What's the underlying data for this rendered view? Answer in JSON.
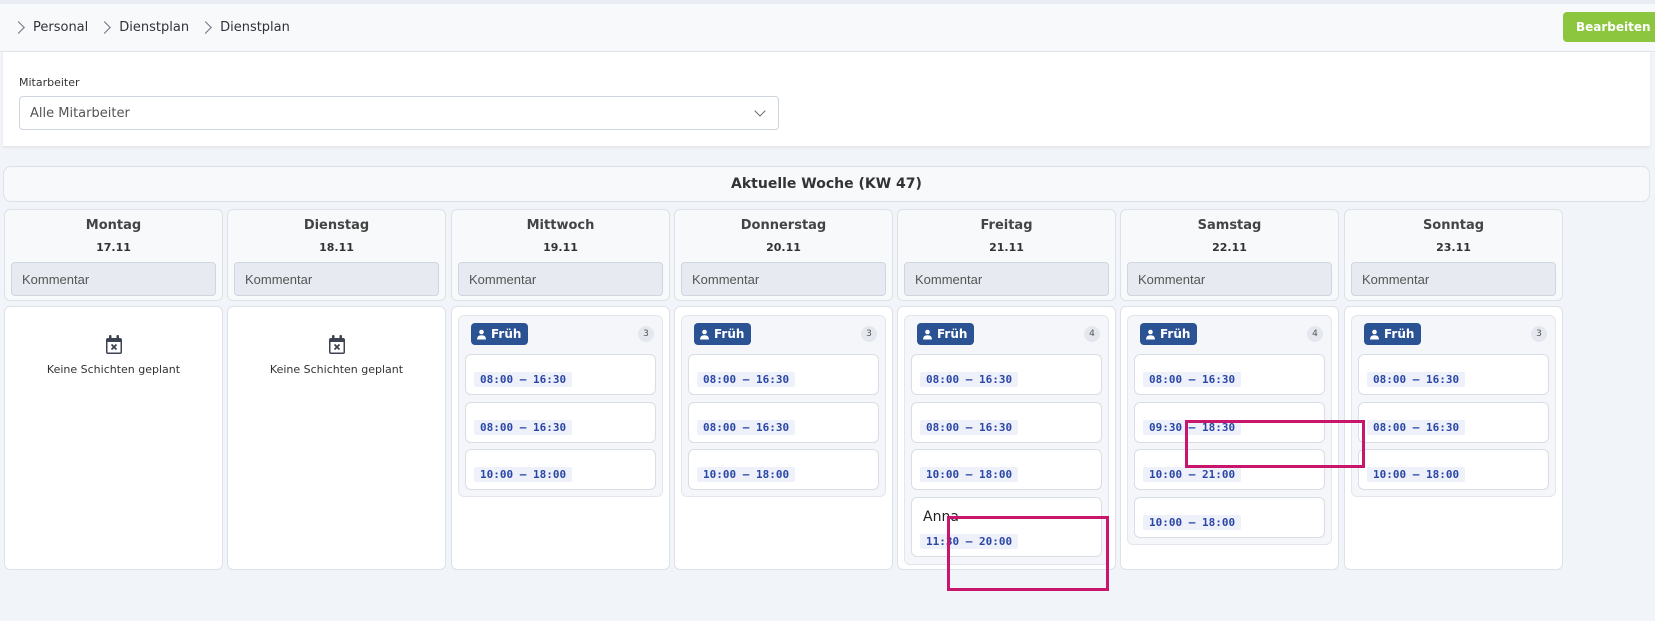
{
  "breadcrumb": [
    "Personal",
    "Dienstplan",
    "Dienstplan"
  ],
  "edit_button": "Bearbeiten",
  "filter": {
    "label": "Mitarbeiter",
    "value": "Alle Mitarbeiter"
  },
  "week_title": "Aktuelle Woche (KW 47)",
  "comment_placeholder": "Kommentar",
  "empty_text": "Keine Schichten geplant",
  "shift_label": "Früh",
  "days": [
    {
      "name": "Montag",
      "date": "17.11"
    },
    {
      "name": "Dienstag",
      "date": "18.11"
    },
    {
      "name": "Mittwoch",
      "date": "19.11",
      "count": "3",
      "shifts": [
        "08:00 – 16:30",
        "08:00 – 16:30",
        "10:00 – 18:00"
      ]
    },
    {
      "name": "Donnerstag",
      "date": "20.11",
      "count": "3",
      "shifts": [
        "08:00 – 16:30",
        "08:00 – 16:30",
        "10:00 – 18:00"
      ]
    },
    {
      "name": "Freitag",
      "date": "21.11",
      "count": "4",
      "shifts": [
        "08:00 – 16:30",
        "08:00 – 16:30",
        "10:00 – 18:00",
        "11:30 – 20:00"
      ],
      "named_employee": "Anna"
    },
    {
      "name": "Samstag",
      "date": "22.11",
      "count": "4",
      "shifts": [
        "08:00 – 16:30",
        "09:30 – 18:30",
        "10:00 – 21:00",
        "10:00 – 18:00"
      ]
    },
    {
      "name": "Sonntag",
      "date": "23.11",
      "count": "3",
      "shifts": [
        "08:00 – 16:30",
        "08:00 – 16:30",
        "10:00 – 18:00"
      ]
    }
  ],
  "colors": {
    "accent_green": "#8cc63f",
    "shift_tag": "#2b5394",
    "time_text": "#2b47a6",
    "highlight": "#c8156e"
  }
}
